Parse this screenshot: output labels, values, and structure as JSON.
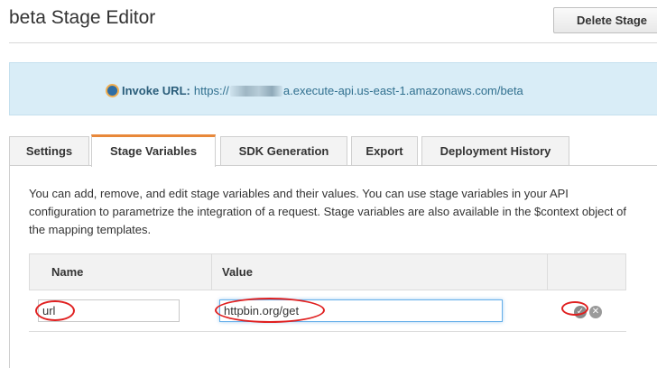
{
  "header": {
    "title": "beta Stage Editor",
    "delete_label": "Delete Stage"
  },
  "invoke": {
    "label": "Invoke URL:",
    "url_prefix": "https://",
    "url_suffix": "a.execute-api.us-east-1.amazonaws.com/beta"
  },
  "tabs": [
    {
      "label": "Settings",
      "active": false
    },
    {
      "label": "Stage Variables",
      "active": true
    },
    {
      "label": "SDK Generation",
      "active": false
    },
    {
      "label": "Export",
      "active": false
    },
    {
      "label": "Deployment History",
      "active": false
    }
  ],
  "description": "You can add, remove, and edit stage variables and their values. You can use stage variables in your API configuration to parametrize the integration of a request. Stage variables are also available in the $context object of the mapping templates.",
  "table": {
    "columns": [
      "Name",
      "Value"
    ],
    "row": {
      "name": "url",
      "value": "httpbin.org/get"
    }
  },
  "icons": {
    "info": "info-circle-icon",
    "confirm": "checkmark-circle-icon",
    "cancel": "close-circle-icon"
  },
  "colors": {
    "accent_tab": "#e8883a",
    "info_bg": "#d9edf7",
    "annotation": "#e02020"
  }
}
